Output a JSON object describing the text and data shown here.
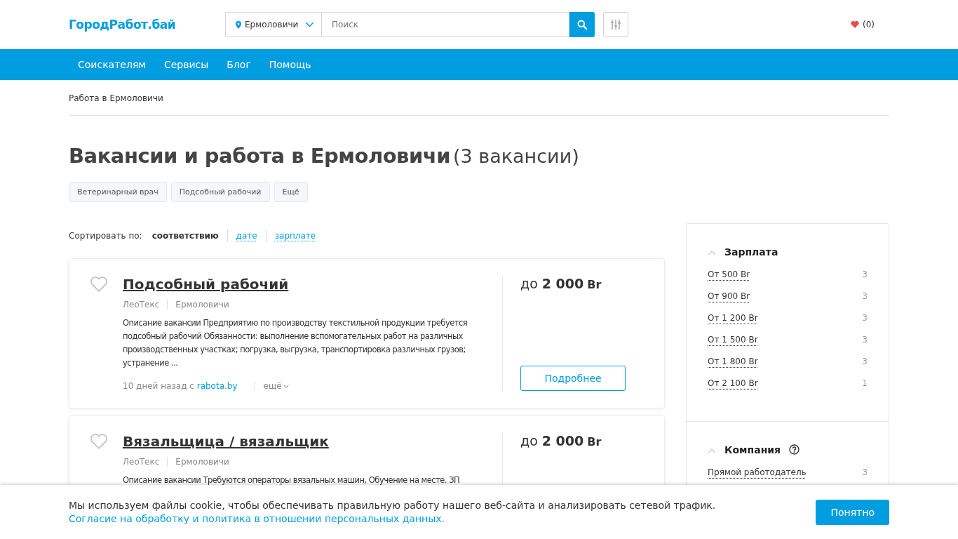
{
  "header": {
    "logo": "ГородРабот.бай",
    "city": "Ермоловичи",
    "search": {
      "placeholder": "Поиск"
    },
    "favorites": "(0)"
  },
  "nav": [
    "Соискателям",
    "Сервисы",
    "Блог",
    "Помощь"
  ],
  "breadcrumb": "Работа в Ермоловичи",
  "title": "Вакансии и работа в Ермоловичи",
  "count": "(3 вакансии)",
  "tags": [
    "Ветеринарный врач",
    "Подсобный рабочий",
    "Ещё"
  ],
  "sort": {
    "label": "Сортировать по:",
    "options": [
      {
        "label": "соответствию",
        "selected": true
      },
      {
        "label": "дате",
        "selected": false
      },
      {
        "label": "зарплате",
        "selected": false
      }
    ]
  },
  "vacancies": [
    {
      "title": "Подсобный рабочий",
      "company": "ЛеоТекс",
      "city": "Ермоловичи",
      "description": "Описание вакансии Предприятию по производству текстильной продукции требуется подсобный рабочий Обязанности: выполнение вспомогательных работ на различных производственных участках; погрузка, выгрузка, транспортировка различных грузов; устранение ...",
      "age": "10 дней назад с",
      "source": "rabota.by",
      "more": "ещё",
      "salary_prefix": "до",
      "salary": "2 000",
      "currency": "Br",
      "button": "Подробнее"
    },
    {
      "title": "Вязальщица / вязальщик",
      "company": "ЛеоТекс",
      "city": "Ермоловичи",
      "description": "Описание вакансии Требуются операторы вязальных машин, Обучение на месте. ЗП",
      "salary_prefix": "до",
      "salary": "2 000",
      "currency": "Br"
    }
  ],
  "filters": [
    {
      "title": "Зарплата",
      "help": false,
      "expanded": true,
      "items": [
        {
          "label": "От 500 Br",
          "count": "3"
        },
        {
          "label": "От 900 Br",
          "count": "3"
        },
        {
          "label": "От 1 200 Br",
          "count": "3"
        },
        {
          "label": "От 1 500 Br",
          "count": "3"
        },
        {
          "label": "От 1 800 Br",
          "count": "3"
        },
        {
          "label": "От 2 100 Br",
          "count": "1"
        }
      ]
    },
    {
      "title": "Компания",
      "help": true,
      "expanded": true,
      "items": [
        {
          "label": "Прямой работодатель",
          "count": "3"
        }
      ]
    }
  ],
  "cookie": {
    "text": "Мы используем файлы cookie, чтобы обеспечивать правильную работу нашего веб-сайта и анализировать сетевой трафик.",
    "link": "Согласие на обработку и политика в отношении персональных данных.",
    "button": "Понятно"
  }
}
